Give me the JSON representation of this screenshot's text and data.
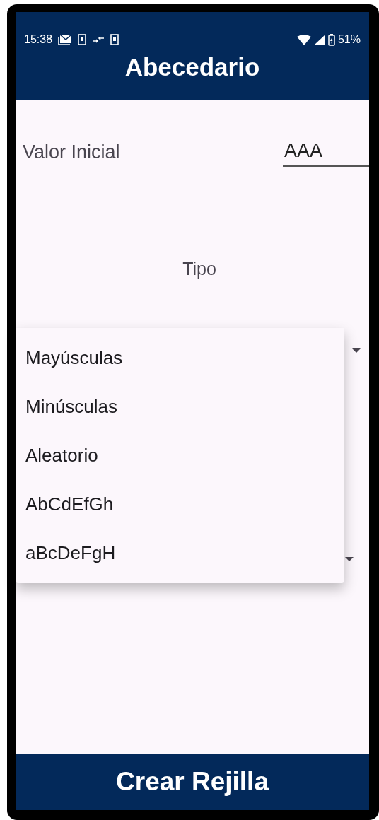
{
  "status_bar": {
    "time": "15:38",
    "battery": "51%"
  },
  "title": "Abecedario",
  "initial_value": {
    "label": "Valor Inicial",
    "value": "AAA"
  },
  "type_label": "Tipo",
  "dropdown_menu": {
    "options": [
      "Mayúsculas",
      "Minúsculas",
      "Aleatorio",
      "AbCdEfGh",
      "aBcDeFgH"
    ]
  },
  "button": "Crear Rejilla"
}
